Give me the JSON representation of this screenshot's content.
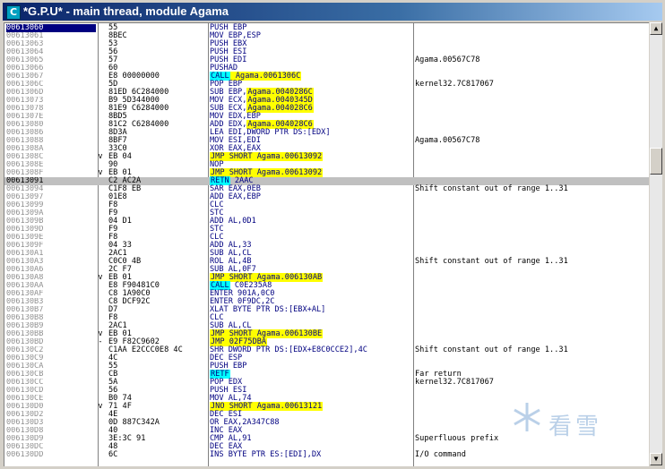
{
  "window": {
    "title": "*G.P.U* - main thread, module Agama",
    "icon_letter": "C"
  },
  "watermark": {
    "text": "看雪"
  },
  "rows": [
    {
      "addr": "00613060",
      "hex": "55",
      "asm": [
        [
          "PUSH EBP",
          ""
        ]
      ],
      "cmt": "",
      "marker": "",
      "selected": true
    },
    {
      "addr": "00613061",
      "hex": "8BEC",
      "asm": [
        [
          "MOV EBP,ESP",
          ""
        ]
      ],
      "cmt": "",
      "marker": ""
    },
    {
      "addr": "00613063",
      "hex": "53",
      "asm": [
        [
          "PUSH EBX",
          ""
        ]
      ],
      "cmt": "",
      "marker": ""
    },
    {
      "addr": "00613064",
      "hex": "56",
      "asm": [
        [
          "PUSH ESI",
          ""
        ]
      ],
      "cmt": "",
      "marker": ""
    },
    {
      "addr": "00613065",
      "hex": "57",
      "asm": [
        [
          "PUSH EDI",
          ""
        ]
      ],
      "cmt": "Agama.00567C78",
      "marker": ""
    },
    {
      "addr": "00613066",
      "hex": "60",
      "asm": [
        [
          "PUSHAD",
          ""
        ]
      ],
      "cmt": "",
      "marker": ""
    },
    {
      "addr": "00613067",
      "hex": "E8 00000000",
      "asm": [
        [
          "CALL",
          "cyan"
        ],
        [
          " Agama.0061306C",
          "yellow"
        ]
      ],
      "cmt": "",
      "marker": ""
    },
    {
      "addr": "0061306C",
      "hex": "5D",
      "asm": [
        [
          "POP EBP",
          ""
        ]
      ],
      "cmt": "kernel32.7C817067",
      "marker": ""
    },
    {
      "addr": "0061306D",
      "hex": "81ED 6C284000",
      "asm": [
        [
          "SUB EBP,",
          ""
        ],
        [
          "Agama.0040286C",
          "yellow"
        ]
      ],
      "cmt": "",
      "marker": ""
    },
    {
      "addr": "00613073",
      "hex": "B9 5D344000",
      "asm": [
        [
          "MOV ECX,",
          ""
        ],
        [
          "Agama.0040345D",
          "yellow"
        ]
      ],
      "cmt": "",
      "marker": ""
    },
    {
      "addr": "00613078",
      "hex": "81E9 C6284000",
      "asm": [
        [
          "SUB ECX,",
          ""
        ],
        [
          "Agama.004028C6",
          "yellow"
        ]
      ],
      "cmt": "",
      "marker": ""
    },
    {
      "addr": "0061307E",
      "hex": "8BD5",
      "asm": [
        [
          "MOV EDX,EBP",
          ""
        ]
      ],
      "cmt": "",
      "marker": ""
    },
    {
      "addr": "00613080",
      "hex": "81C2 C6284000",
      "asm": [
        [
          "ADD EDX,",
          ""
        ],
        [
          "Agama.004028C6",
          "yellow"
        ]
      ],
      "cmt": "",
      "marker": ""
    },
    {
      "addr": "00613086",
      "hex": "8D3A",
      "asm": [
        [
          "LEA EDI,DWORD PTR DS:[EDX]",
          ""
        ]
      ],
      "cmt": "",
      "marker": ""
    },
    {
      "addr": "00613088",
      "hex": "8BF7",
      "asm": [
        [
          "MOV ESI,EDI",
          ""
        ]
      ],
      "cmt": "Agama.00567C78",
      "marker": ""
    },
    {
      "addr": "0061308A",
      "hex": "33C0",
      "asm": [
        [
          "XOR EAX,EAX",
          ""
        ]
      ],
      "cmt": "",
      "marker": ""
    },
    {
      "addr": "0061308C",
      "hex": "EB 04",
      "asm": [
        [
          "JMP SHORT Agama.00613092",
          "yellow"
        ]
      ],
      "cmt": "",
      "marker": "v"
    },
    {
      "addr": "0061308E",
      "hex": "90",
      "asm": [
        [
          "NOP",
          ""
        ]
      ],
      "cmt": "",
      "marker": ""
    },
    {
      "addr": "0061308F",
      "hex": "EB 01",
      "asm": [
        [
          "JMP SHORT Agama.00613092",
          "yellow"
        ]
      ],
      "cmt": "",
      "marker": "v"
    },
    {
      "addr": "00613091",
      "hex": "C2 AC2A",
      "asm": [
        [
          "RETN",
          "cyan"
        ],
        [
          " 2AAC",
          ""
        ]
      ],
      "cmt": "",
      "marker": "",
      "current": true
    },
    {
      "addr": "00613094",
      "hex": "C1F8 EB",
      "asm": [
        [
          "SAR EAX,0EB",
          ""
        ]
      ],
      "cmt": "Shift constant out of range 1..31",
      "marker": ""
    },
    {
      "addr": "00613097",
      "hex": "01E8",
      "asm": [
        [
          "ADD EAX,EBP",
          ""
        ]
      ],
      "cmt": "",
      "marker": ""
    },
    {
      "addr": "00613099",
      "hex": "F8",
      "asm": [
        [
          "CLC",
          ""
        ]
      ],
      "cmt": "",
      "marker": ""
    },
    {
      "addr": "0061309A",
      "hex": "F9",
      "asm": [
        [
          "STC",
          ""
        ]
      ],
      "cmt": "",
      "marker": ""
    },
    {
      "addr": "0061309B",
      "hex": "04 D1",
      "asm": [
        [
          "ADD AL,0D1",
          ""
        ]
      ],
      "cmt": "",
      "marker": ""
    },
    {
      "addr": "0061309D",
      "hex": "F9",
      "asm": [
        [
          "STC",
          ""
        ]
      ],
      "cmt": "",
      "marker": ""
    },
    {
      "addr": "0061309E",
      "hex": "F8",
      "asm": [
        [
          "CLC",
          ""
        ]
      ],
      "cmt": "",
      "marker": ""
    },
    {
      "addr": "0061309F",
      "hex": "04 33",
      "asm": [
        [
          "ADD AL,33",
          ""
        ]
      ],
      "cmt": "",
      "marker": ""
    },
    {
      "addr": "006130A1",
      "hex": "2AC1",
      "asm": [
        [
          "SUB AL,CL",
          ""
        ]
      ],
      "cmt": "",
      "marker": ""
    },
    {
      "addr": "006130A3",
      "hex": "C0C0 4B",
      "asm": [
        [
          "ROL AL,4B",
          ""
        ]
      ],
      "cmt": "Shift constant out of range 1..31",
      "marker": ""
    },
    {
      "addr": "006130A6",
      "hex": "2C F7",
      "asm": [
        [
          "SUB AL,0F7",
          ""
        ]
      ],
      "cmt": "",
      "marker": ""
    },
    {
      "addr": "006130A8",
      "hex": "EB 01",
      "asm": [
        [
          "JMP SHORT Agama.006130AB",
          "yellow"
        ]
      ],
      "cmt": "",
      "marker": "v"
    },
    {
      "addr": "006130AA",
      "hex": "E8 F90481C0",
      "asm": [
        [
          "CALL",
          "cyan"
        ],
        [
          " C0E235A8",
          ""
        ]
      ],
      "cmt": "",
      "marker": ""
    },
    {
      "addr": "006130AF",
      "hex": "C8 1A90C0",
      "asm": [
        [
          "ENTER 901A,0C0",
          ""
        ]
      ],
      "cmt": "",
      "marker": ""
    },
    {
      "addr": "006130B3",
      "hex": "C8 DCF92C",
      "asm": [
        [
          "ENTER 0F9DC,2C",
          ""
        ]
      ],
      "cmt": "",
      "marker": ""
    },
    {
      "addr": "006130B7",
      "hex": "D7",
      "asm": [
        [
          "XLAT BYTE PTR DS:[EBX+AL]",
          ""
        ]
      ],
      "cmt": "",
      "marker": ""
    },
    {
      "addr": "006130B8",
      "hex": "F8",
      "asm": [
        [
          "CLC",
          ""
        ]
      ],
      "cmt": "",
      "marker": ""
    },
    {
      "addr": "006130B9",
      "hex": "2AC1",
      "asm": [
        [
          "SUB AL,CL",
          ""
        ]
      ],
      "cmt": "",
      "marker": ""
    },
    {
      "addr": "006130BB",
      "hex": "EB 01",
      "asm": [
        [
          "JMP SHORT Agama.006130BE",
          "yellow"
        ]
      ],
      "cmt": "",
      "marker": "v"
    },
    {
      "addr": "006130BD",
      "hex": "E9 F82C9602",
      "asm": [
        [
          "JMP 02F75DBA",
          "yellow"
        ]
      ],
      "cmt": "",
      "marker": "-"
    },
    {
      "addr": "006130C2",
      "hex": "C1AA E2CCC0E8 4C",
      "asm": [
        [
          "SHR DWORD PTR DS:[EDX+E8C0CCE2],4C",
          ""
        ]
      ],
      "cmt": "Shift constant out of range 1..31",
      "marker": ""
    },
    {
      "addr": "006130C9",
      "hex": "4C",
      "asm": [
        [
          "DEC ESP",
          ""
        ]
      ],
      "cmt": "",
      "marker": ""
    },
    {
      "addr": "006130CA",
      "hex": "55",
      "asm": [
        [
          "PUSH EBP",
          ""
        ]
      ],
      "cmt": "",
      "marker": ""
    },
    {
      "addr": "006130CB",
      "hex": "CB",
      "asm": [
        [
          "RETF",
          "cyan"
        ]
      ],
      "cmt": "Far return",
      "marker": ""
    },
    {
      "addr": "006130CC",
      "hex": "5A",
      "asm": [
        [
          "POP EDX",
          ""
        ]
      ],
      "cmt": "kernel32.7C817067",
      "marker": ""
    },
    {
      "addr": "006130CD",
      "hex": "56",
      "asm": [
        [
          "PUSH ESI",
          ""
        ]
      ],
      "cmt": "",
      "marker": ""
    },
    {
      "addr": "006130CE",
      "hex": "B0 74",
      "asm": [
        [
          "MOV AL,74",
          ""
        ]
      ],
      "cmt": "",
      "marker": ""
    },
    {
      "addr": "006130D0",
      "hex": "71 4F",
      "asm": [
        [
          "JNO SHORT Agama.00613121",
          "yellow"
        ]
      ],
      "cmt": "",
      "marker": "v"
    },
    {
      "addr": "006130D2",
      "hex": "4E",
      "asm": [
        [
          "DEC ESI",
          ""
        ]
      ],
      "cmt": "",
      "marker": ""
    },
    {
      "addr": "006130D3",
      "hex": "0D 887C342A",
      "asm": [
        [
          "OR EAX,2A347C88",
          ""
        ]
      ],
      "cmt": "",
      "marker": ""
    },
    {
      "addr": "006130D8",
      "hex": "40",
      "asm": [
        [
          "INC EAX",
          ""
        ]
      ],
      "cmt": "",
      "marker": ""
    },
    {
      "addr": "006130D9",
      "hex": "3E:3C 91",
      "asm": [
        [
          "CMP AL,91",
          ""
        ]
      ],
      "cmt": "Superfluous prefix",
      "marker": ""
    },
    {
      "addr": "006130DC",
      "hex": "48",
      "asm": [
        [
          "DEC EAX",
          ""
        ]
      ],
      "cmt": "",
      "marker": ""
    },
    {
      "addr": "006130DD",
      "hex": "6C",
      "asm": [
        [
          "INS BYTE PTR ES:[EDI],DX",
          ""
        ]
      ],
      "cmt": "I/O command",
      "marker": ""
    }
  ]
}
